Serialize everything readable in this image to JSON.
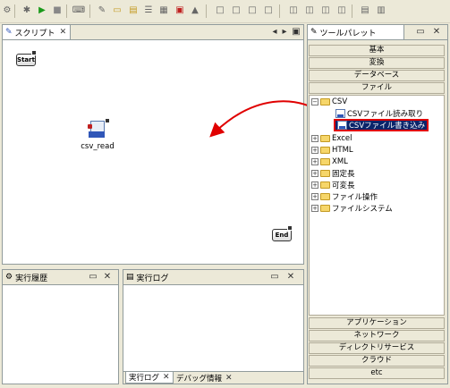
{
  "toolbar": {
    "buttons": [
      "settings-icon",
      "run-icon",
      "stop-icon",
      "keyboard-icon",
      "tools-icon",
      "folder-icon",
      "document-icon",
      "debug-icon",
      "list-icon",
      "grid-icon",
      "graduation-icon",
      "layout-1-icon",
      "layout-2-icon",
      "layout-3-icon",
      "layout-4-icon",
      "align-1-icon",
      "align-2-icon",
      "align-3-icon",
      "align-4-icon",
      "stack-1-icon",
      "stack-2-icon"
    ]
  },
  "script_panel": {
    "tab_label": "スクリプト",
    "nodes": {
      "start": "Start",
      "csv_read": "csv_read",
      "end": "End"
    }
  },
  "palette": {
    "title": "ツールパレット",
    "categories_top": [
      "基本",
      "変換",
      "データベース",
      "ファイル"
    ],
    "tree": {
      "csv": "CSV",
      "csv_read": "CSVファイル読み取り",
      "csv_write": "CSVファイル書き込み",
      "excel": "Excel",
      "html": "HTML",
      "xml": "XML",
      "fixed": "固定長",
      "variable": "可変長",
      "file_ops": "ファイル操作",
      "filesystem": "ファイルシステム"
    },
    "categories_bottom": [
      "アプリケーション",
      "ネットワーク",
      "ディレクトリサービス",
      "クラウド",
      "etc"
    ]
  },
  "history_panel": {
    "tab_label": "実行履歴"
  },
  "log_panel": {
    "tab_label": "実行ログ",
    "bottom_tabs": [
      "実行ログ",
      "デバッグ情報"
    ]
  },
  "colors": {
    "selection_border": "#e00000",
    "arrow": "#e00000",
    "selection_bg": "#0a246a"
  }
}
